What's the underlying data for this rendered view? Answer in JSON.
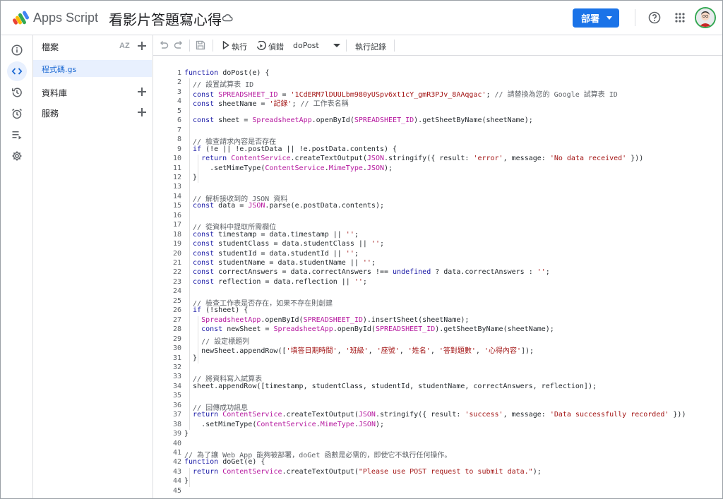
{
  "header": {
    "brand": "Apps Script",
    "project_title": "看影片答題寫心得",
    "deploy_label": "部署"
  },
  "rail": {
    "items": [
      {
        "name": "info-icon",
        "active": false
      },
      {
        "name": "code-icon",
        "active": true
      },
      {
        "name": "history-icon",
        "active": false
      },
      {
        "name": "alarm-icon",
        "active": false
      },
      {
        "name": "executions-icon",
        "active": false
      },
      {
        "name": "settings-icon",
        "active": false
      }
    ]
  },
  "files_panel": {
    "files_label": "檔案",
    "sort_label": "AZ",
    "active_file": "程式碼.gs",
    "libraries_label": "資料庫",
    "services_label": "服務"
  },
  "toolbar": {
    "run_label": "執行",
    "debug_label": "偵錯",
    "function_select": "doPost",
    "log_label": "執行記錄"
  },
  "colors": {
    "accent": "#1a73e8",
    "keyword": "#1a1aa6",
    "string": "#a31515",
    "class": "#b5179e",
    "comment": "#5f6368"
  },
  "code_lines": [
    [
      [
        "kw",
        "function"
      ],
      [
        "def",
        " doPost(e) {"
      ]
    ],
    [
      [
        "cm",
        "  // 設置試算表 ID"
      ]
    ],
    [
      [
        "kw",
        "  const"
      ],
      [
        "cls",
        " SPREADSHEET_ID"
      ],
      [
        "def",
        " = "
      ],
      [
        "str",
        "'1CdERM7lDUULbm980yUSpv6xt1cY_gmR3PJv_8AAqgac'"
      ],
      [
        "def",
        "; "
      ],
      [
        "cm",
        "// 請替換為您的 Google 試算表 ID"
      ]
    ],
    [
      [
        "kw",
        "  const"
      ],
      [
        "def",
        " sheetName = "
      ],
      [
        "str",
        "'記錄'"
      ],
      [
        "def",
        "; "
      ],
      [
        "cm",
        "// 工作表名稱"
      ]
    ],
    [],
    [
      [
        "kw",
        "  const"
      ],
      [
        "def",
        " sheet = "
      ],
      [
        "cls",
        "SpreadsheetApp"
      ],
      [
        "def",
        ".openById("
      ],
      [
        "cls",
        "SPREADSHEET_ID"
      ],
      [
        "def",
        ").getSheetByName(sheetName);"
      ]
    ],
    [],
    [
      [
        "cm",
        "  // 檢查請求內容是否存在"
      ]
    ],
    [
      [
        "kw",
        "  if"
      ],
      [
        "def",
        " (!e || !e.postData || !e.postData.contents) {"
      ]
    ],
    [
      [
        "kw",
        "    return"
      ],
      [
        "cls",
        " ContentService"
      ],
      [
        "def",
        ".createTextOutput("
      ],
      [
        "cls",
        "JSON"
      ],
      [
        "def",
        ".stringify({ result: "
      ],
      [
        "str",
        "'error'"
      ],
      [
        "def",
        ", message: "
      ],
      [
        "str",
        "'No data received'"
      ],
      [
        "def",
        " }))"
      ]
    ],
    [
      [
        "def",
        "      .setMimeType("
      ],
      [
        "cls",
        "ContentService"
      ],
      [
        "def",
        "."
      ],
      [
        "cls",
        "MimeType"
      ],
      [
        "def",
        "."
      ],
      [
        "cls",
        "JSON"
      ],
      [
        "def",
        ");"
      ]
    ],
    [
      [
        "def",
        "  }"
      ]
    ],
    [],
    [
      [
        "cm",
        "  // 解析接收到的 JSON 資料"
      ]
    ],
    [
      [
        "kw",
        "  const"
      ],
      [
        "def",
        " data = "
      ],
      [
        "cls",
        "JSON"
      ],
      [
        "def",
        ".parse(e.postData.contents);"
      ]
    ],
    [],
    [
      [
        "cm",
        "  // 從資料中提取所需欄位"
      ]
    ],
    [
      [
        "kw",
        "  const"
      ],
      [
        "def",
        " timestamp = data.timestamp || "
      ],
      [
        "str",
        "''"
      ],
      [
        "def",
        ";"
      ]
    ],
    [
      [
        "kw",
        "  const"
      ],
      [
        "def",
        " studentClass = data.studentClass || "
      ],
      [
        "str",
        "''"
      ],
      [
        "def",
        ";"
      ]
    ],
    [
      [
        "kw",
        "  const"
      ],
      [
        "def",
        " studentId = data.studentId || "
      ],
      [
        "str",
        "''"
      ],
      [
        "def",
        ";"
      ]
    ],
    [
      [
        "kw",
        "  const"
      ],
      [
        "def",
        " studentName = data.studentName || "
      ],
      [
        "str",
        "''"
      ],
      [
        "def",
        ";"
      ]
    ],
    [
      [
        "kw",
        "  const"
      ],
      [
        "def",
        " correctAnswers = data.correctAnswers !== "
      ],
      [
        "kw",
        "undefined"
      ],
      [
        "def",
        " ? data.correctAnswers : "
      ],
      [
        "str",
        "''"
      ],
      [
        "def",
        ";"
      ]
    ],
    [
      [
        "kw",
        "  const"
      ],
      [
        "def",
        " reflection = data.reflection || "
      ],
      [
        "str",
        "''"
      ],
      [
        "def",
        ";"
      ]
    ],
    [],
    [
      [
        "cm",
        "  // 檢查工作表是否存在，如果不存在則創建"
      ]
    ],
    [
      [
        "kw",
        "  if"
      ],
      [
        "def",
        " (!sheet) {"
      ]
    ],
    [
      [
        "cls",
        "    SpreadsheetApp"
      ],
      [
        "def",
        ".openById("
      ],
      [
        "cls",
        "SPREADSHEET_ID"
      ],
      [
        "def",
        ").insertSheet(sheetName);"
      ]
    ],
    [
      [
        "kw",
        "    const"
      ],
      [
        "def",
        " newSheet = "
      ],
      [
        "cls",
        "SpreadsheetApp"
      ],
      [
        "def",
        ".openById("
      ],
      [
        "cls",
        "SPREADSHEET_ID"
      ],
      [
        "def",
        ").getSheetByName(sheetName);"
      ]
    ],
    [
      [
        "cm",
        "    // 設定標題列"
      ]
    ],
    [
      [
        "def",
        "    newSheet.appendRow(["
      ],
      [
        "str",
        "'填答日期時間'"
      ],
      [
        "def",
        ", "
      ],
      [
        "str",
        "'班級'"
      ],
      [
        "def",
        ", "
      ],
      [
        "str",
        "'座號'"
      ],
      [
        "def",
        ", "
      ],
      [
        "str",
        "'姓名'"
      ],
      [
        "def",
        ", "
      ],
      [
        "str",
        "'答對題數'"
      ],
      [
        "def",
        ", "
      ],
      [
        "str",
        "'心得內容'"
      ],
      [
        "def",
        "]);"
      ]
    ],
    [
      [
        "def",
        "  }"
      ]
    ],
    [],
    [
      [
        "cm",
        "  // 將資料寫入試算表"
      ]
    ],
    [
      [
        "def",
        "  sheet.appendRow([timestamp, studentClass, studentId, studentName, correctAnswers, reflection]);"
      ]
    ],
    [],
    [
      [
        "cm",
        "  // 回傳成功訊息"
      ]
    ],
    [
      [
        "kw",
        "  return"
      ],
      [
        "cls",
        " ContentService"
      ],
      [
        "def",
        ".createTextOutput("
      ],
      [
        "cls",
        "JSON"
      ],
      [
        "def",
        ".stringify({ result: "
      ],
      [
        "str",
        "'success'"
      ],
      [
        "def",
        ", message: "
      ],
      [
        "str",
        "'Data successfully recorded'"
      ],
      [
        "def",
        " }))"
      ]
    ],
    [
      [
        "def",
        "    .setMimeType("
      ],
      [
        "cls",
        "ContentService"
      ],
      [
        "def",
        "."
      ],
      [
        "cls",
        "MimeType"
      ],
      [
        "def",
        "."
      ],
      [
        "cls",
        "JSON"
      ],
      [
        "def",
        ");"
      ]
    ],
    [
      [
        "def",
        "}"
      ]
    ],
    [],
    [
      [
        "cm",
        "// 為了讓 Web App 能夠被部署，doGet 函數是必需的，即使它不執行任何操作。"
      ]
    ],
    [
      [
        "kw",
        "function"
      ],
      [
        "def",
        " doGet(e) {"
      ]
    ],
    [
      [
        "kw",
        "  return"
      ],
      [
        "cls",
        " ContentService"
      ],
      [
        "def",
        ".createTextOutput("
      ],
      [
        "str",
        "\"Please use POST request to submit data.\""
      ],
      [
        "def",
        ");"
      ]
    ],
    [
      [
        "def",
        "}"
      ]
    ],
    []
  ]
}
